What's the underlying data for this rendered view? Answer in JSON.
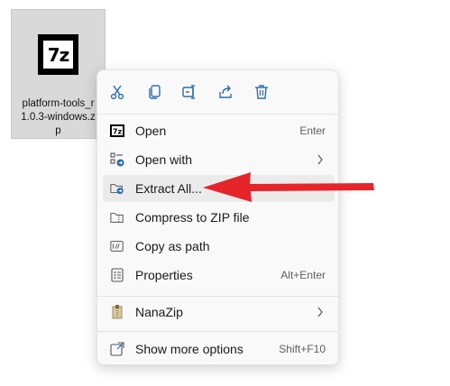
{
  "file": {
    "name_lines": [
      "platform-tools_r",
      "1.0.3-windows.z",
      "p"
    ],
    "icon_text": "7z"
  },
  "context_menu": {
    "quick_actions": [
      {
        "name": "cut-icon"
      },
      {
        "name": "copy-icon"
      },
      {
        "name": "rename-icon"
      },
      {
        "name": "share-icon"
      },
      {
        "name": "delete-icon"
      }
    ],
    "items": [
      {
        "label": "Open",
        "shortcut": "Enter",
        "icon": "7z-icon"
      },
      {
        "label": "Open with",
        "shortcut": "",
        "icon": "open-with-icon",
        "submenu": true
      },
      {
        "label": "Extract All...",
        "shortcut": "",
        "icon": "extract-folder-icon"
      },
      {
        "label": "Compress to ZIP file",
        "shortcut": "",
        "icon": "zip-folder-icon"
      },
      {
        "label": "Copy as path",
        "shortcut": "",
        "icon": "copy-path-icon"
      },
      {
        "label": "Properties",
        "shortcut": "Alt+Enter",
        "icon": "properties-icon"
      },
      {
        "label": "NanaZip",
        "shortcut": "",
        "icon": "nanazip-icon",
        "submenu": true
      },
      {
        "label": "Show more options",
        "shortcut": "Shift+F10",
        "icon": "show-more-icon"
      }
    ]
  },
  "colors": {
    "accent_blue": "#2b6cb0",
    "annotation_red": "#e5252a",
    "selection_bg": "#d9d9d9",
    "menu_bg": "#f9f9f9"
  }
}
